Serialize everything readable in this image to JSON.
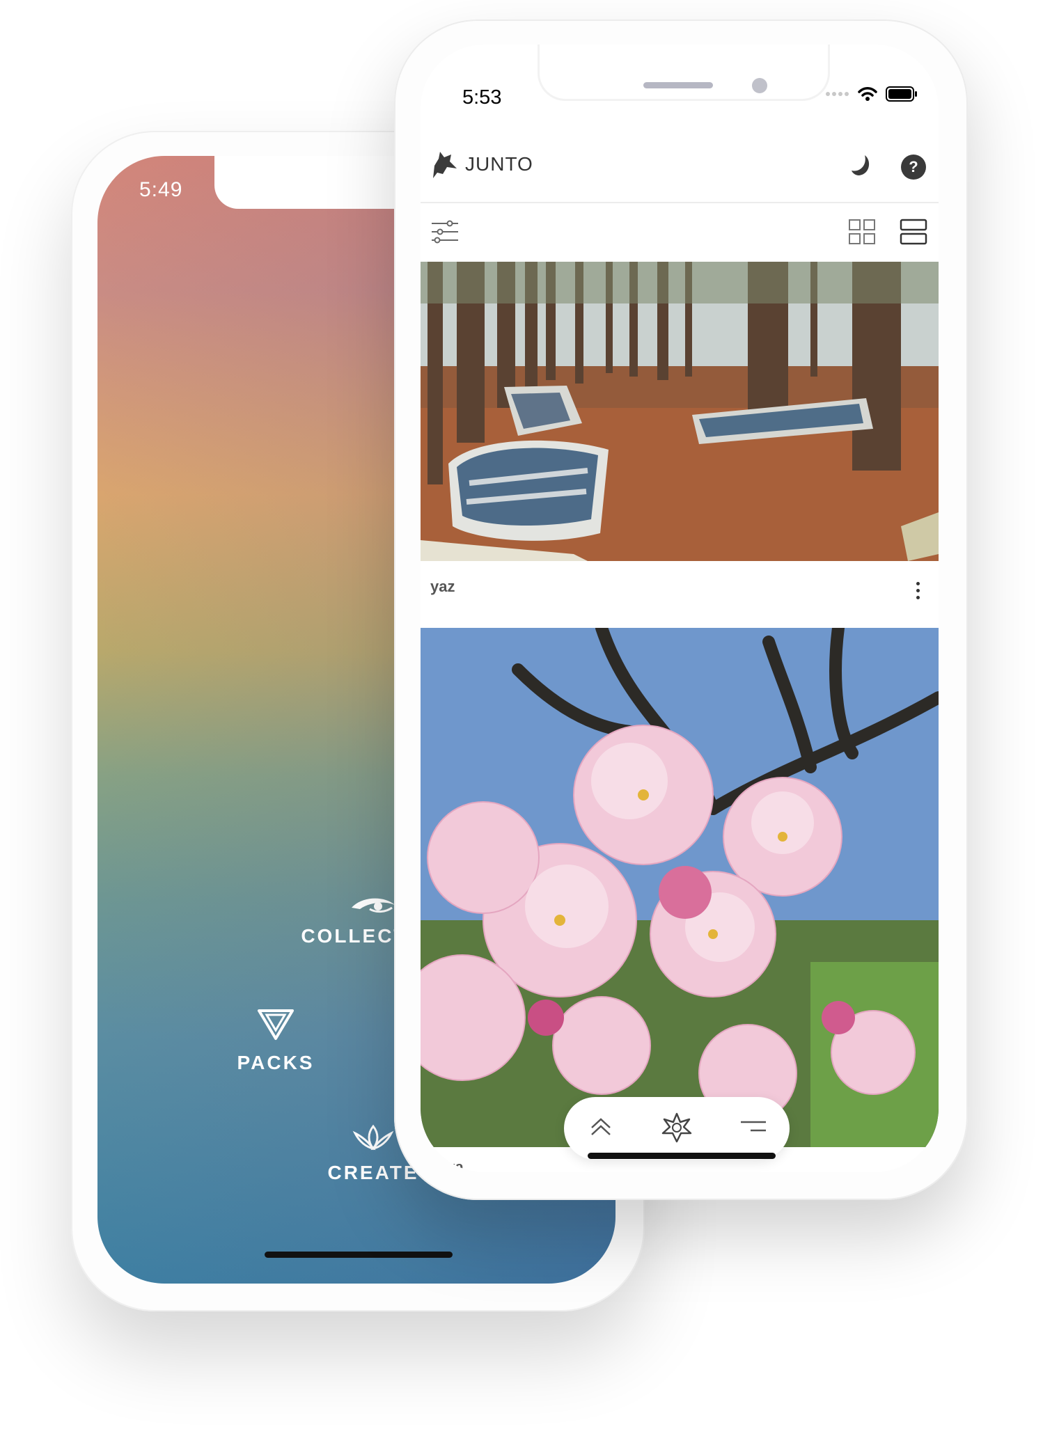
{
  "back_phone": {
    "status_time": "5:49",
    "menu": [
      {
        "label": "COLLECTIVE",
        "icon": "eye-icon"
      },
      {
        "label": "PACKS",
        "icon": "triangle-icon"
      },
      {
        "label": "CREATE",
        "icon": "lotus-icon"
      }
    ]
  },
  "front_phone": {
    "status_time": "5:53",
    "app_title": "JUNTO",
    "header_icons": [
      "wolf-logo-icon",
      "moon-icon",
      "help-icon"
    ],
    "help_label": "?",
    "toolbar_icons": [
      "filter-sliders-icon",
      "grid-view-icon",
      "list-view-icon"
    ],
    "posts": [
      {
        "author": "yaz",
        "image": "rowboats-in-pine-forest"
      },
      {
        "author": "dora",
        "image": "cherry-blossoms"
      }
    ],
    "bottom_nav": [
      "chevron-up-icon",
      "junto-star-icon",
      "menu-lines-icon"
    ]
  }
}
